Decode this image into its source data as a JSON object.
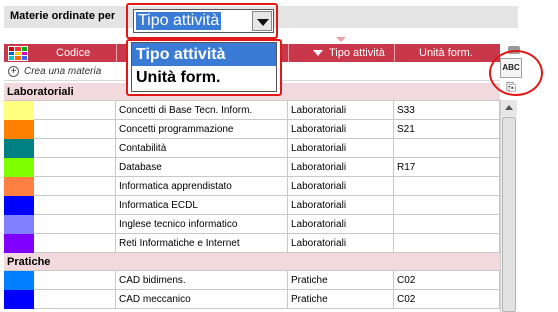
{
  "toolbar": {
    "sort_label": "Materie ordinate per"
  },
  "dropdown": {
    "selected": "Tipo attività",
    "options": [
      "Tipo attività",
      "Unità form."
    ]
  },
  "header": {
    "columns": [
      "Codice",
      "Tipo attività",
      "Unità form."
    ]
  },
  "create_row": {
    "label": "Crea una materia"
  },
  "groups": [
    {
      "name": "Laboratoriali",
      "rows": [
        {
          "color": "#ffff80",
          "name": "Concetti di Base Tecn. Inform.",
          "type": "Laboratoriali",
          "unit": "S33"
        },
        {
          "color": "#ff8000",
          "name": "Concetti programmazione",
          "type": "Laboratoriali",
          "unit": "S21"
        },
        {
          "color": "#008080",
          "name": "Contabilità",
          "type": "Laboratoriali",
          "unit": ""
        },
        {
          "color": "#80ff00",
          "name": "Database",
          "type": "Laboratoriali",
          "unit": "R17"
        },
        {
          "color": "#ff8040",
          "name": "Informatica apprendistato",
          "type": "Laboratoriali",
          "unit": ""
        },
        {
          "color": "#0000ff",
          "name": "Informatica ECDL",
          "type": "Laboratoriali",
          "unit": ""
        },
        {
          "color": "#8080ff",
          "name": "Inglese tecnico informatico",
          "type": "Laboratoriali",
          "unit": ""
        },
        {
          "color": "#8000ff",
          "name": "Reti Informatiche e  Internet",
          "type": "Laboratoriali",
          "unit": ""
        }
      ]
    },
    {
      "name": "Pratiche",
      "rows": [
        {
          "color": "#0080ff",
          "name": "CAD bidimens.",
          "type": "Pratiche",
          "unit": "C02"
        },
        {
          "color": "#0000ff",
          "name": "CAD meccanico",
          "type": "Pratiche",
          "unit": "C02"
        }
      ]
    }
  ],
  "tools": {
    "spellcheck_label": "ABC"
  },
  "icons": {
    "grid": "color-grid-icon",
    "plus": "plus-icon",
    "spellcheck": "abc-icon",
    "copy": "copy-icon"
  },
  "colors": {
    "header_bg": "#c8384a",
    "group_bg": "#f2d9dd",
    "highlight": "#e01818",
    "selection": "#3a7bd5"
  }
}
